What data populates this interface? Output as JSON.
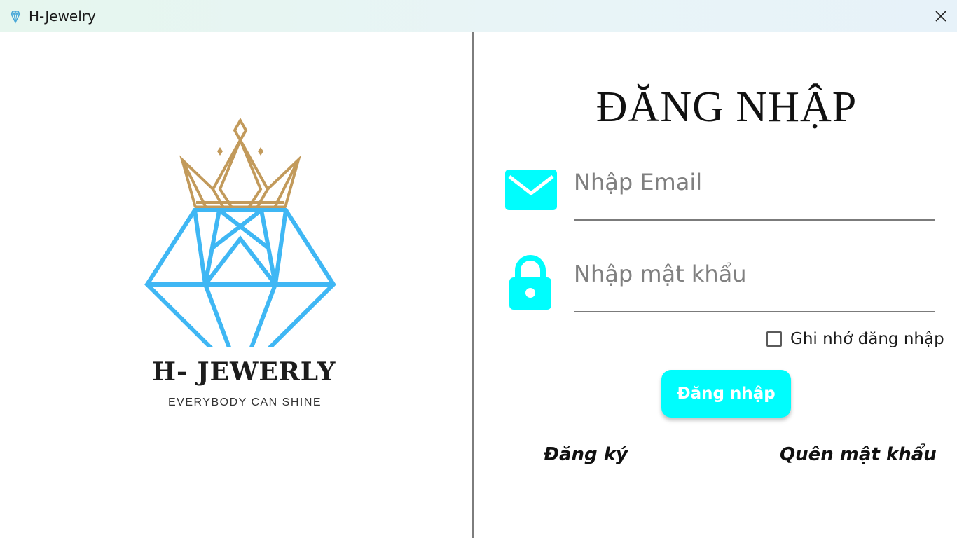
{
  "window": {
    "title": "H-Jewelry",
    "close_icon": "close-icon"
  },
  "brand": {
    "name": "H- JEWERLY",
    "tagline": "EVERYBODY CAN SHINE",
    "colors": {
      "crown": "#c29a5b",
      "diamond": "#3fb7f4"
    }
  },
  "login": {
    "title": "ĐĂNG NHẬP",
    "email_placeholder": "Nhập Email",
    "email_value": "",
    "password_placeholder": "Nhập mật khẩu",
    "password_value": "",
    "remember_label": "Ghi nhớ đăng nhập",
    "remember_checked": false,
    "submit_label": "Đăng nhập",
    "signup_link": "Đăng ký",
    "forgot_link": "Quên mật khẩu",
    "accent_color": "#00fdfd",
    "icons": {
      "email": "mail-icon",
      "password": "lock-icon"
    }
  }
}
